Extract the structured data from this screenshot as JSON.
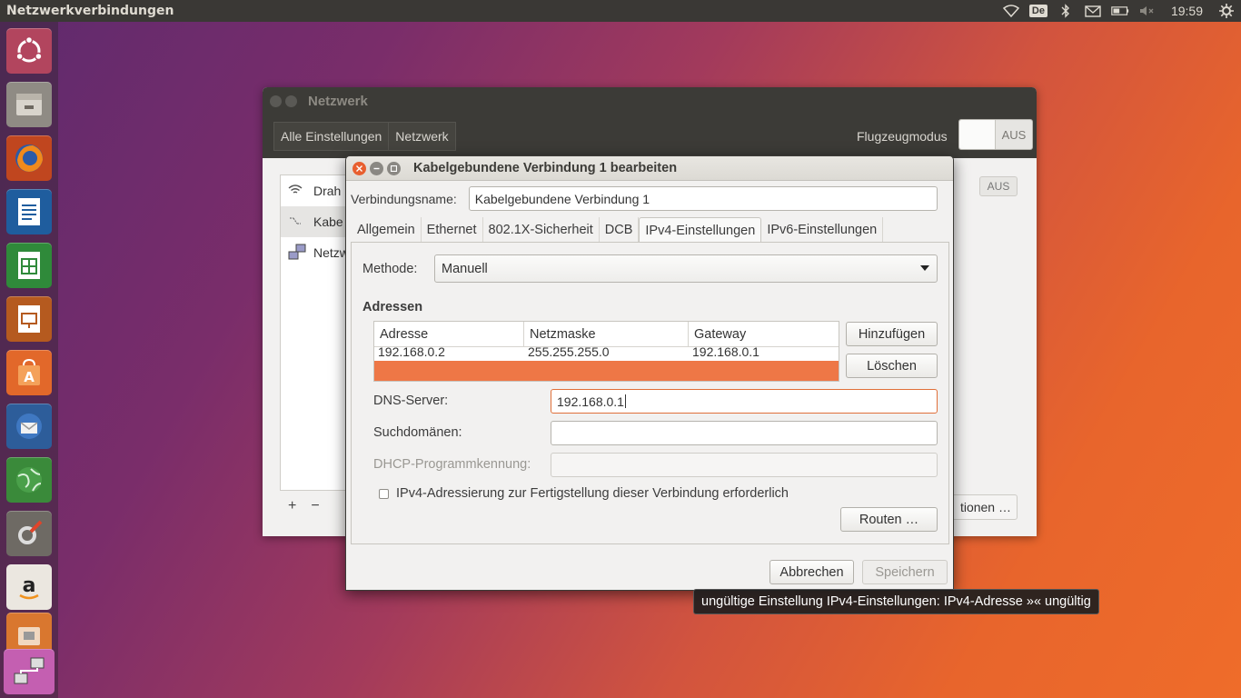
{
  "top_panel": {
    "app_title": "Netzwerkverbindungen",
    "keyboard_layout": "De",
    "clock": "19:59",
    "icons": [
      "wifi-icon",
      "keyboard-icon",
      "bluetooth-icon",
      "mail-icon",
      "battery-icon",
      "volume-muted-icon",
      "gear-icon"
    ]
  },
  "launcher": {
    "items": [
      "ubuntu-dash-icon",
      "files-icon",
      "firefox-icon",
      "writer-icon",
      "calc-icon",
      "impress-icon",
      "software-center-icon",
      "thunderbird-icon",
      "network-globe-icon",
      "system-settings-icon",
      "amazon-icon",
      "trash-app-icon",
      "network-connections-icon"
    ]
  },
  "bg_window": {
    "title": "Netzwerk",
    "breadcrumb": [
      "Alle Einstellungen",
      "Netzwerk"
    ],
    "flight_mode_label": "Flugzeugmodus",
    "flight_mode_state": "AUS",
    "list_items": [
      "Drah",
      "Kabe",
      "Netzw"
    ],
    "switch2_state": "AUS",
    "options_button": "tionen …",
    "plus": "+",
    "minus": "−"
  },
  "dialog": {
    "title": "Kabelgebundene Verbindung 1 bearbeiten",
    "connection_name_label": "Verbindungsname:",
    "connection_name_value": "Kabelgebundene Verbindung 1",
    "tabs": [
      "Allgemein",
      "Ethernet",
      "802.1X-Sicherheit",
      "DCB",
      "IPv4-Einstellungen",
      "IPv6-Einstellungen"
    ],
    "active_tab": "IPv4-Einstellungen",
    "method_label": "Methode:",
    "method_value": "Manuell",
    "addresses_heading": "Adressen",
    "table": {
      "columns": [
        "Adresse",
        "Netzmaske",
        "Gateway"
      ],
      "rows": [
        [
          "192.168.0.2",
          "255.255.255.0",
          "192.168.0.1"
        ]
      ]
    },
    "add_button": "Hinzufügen",
    "delete_button": "Löschen",
    "dns_label": "DNS-Server:",
    "dns_value": "192.168.0.1",
    "search_domains_label": "Suchdomänen:",
    "search_domains_value": "",
    "dhcp_label": "DHCP-Programmkennung:",
    "dhcp_value": "",
    "require_ipv4_label": "IPv4-Adressierung zur Fertigstellung dieser Verbindung erforderlich",
    "require_ipv4_checked": false,
    "routes_button": "Routen …",
    "cancel_button": "Abbrechen",
    "save_button": "Speichern",
    "save_enabled": false
  },
  "tooltip": "ungültige Einstellung IPv4-Einstellungen: IPv4-Adresse »« ungültig",
  "colors": {
    "accent": "#e95420",
    "selection": "#ee7746",
    "panel": "#3a3835"
  }
}
